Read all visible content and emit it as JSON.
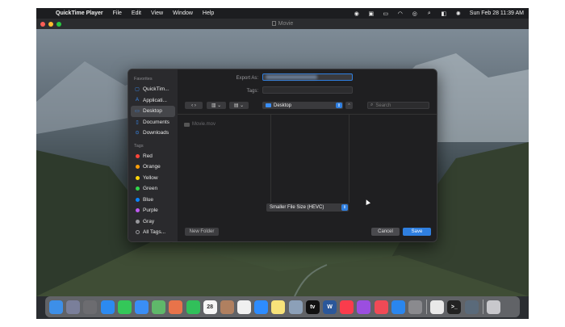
{
  "menubar": {
    "app_name": "QuickTime Player",
    "items": [
      "File",
      "Edit",
      "View",
      "Window",
      "Help"
    ],
    "clock": "Sun Feb 28  11:39 AM"
  },
  "window": {
    "title": "Movie"
  },
  "dialog": {
    "export_as_label": "Export As:",
    "tags_label": "Tags:",
    "location": "Desktop",
    "search_placeholder": "Search",
    "file_name": "Movie.mov",
    "format": "Smaller File Size (HEVC)",
    "new_folder": "New Folder",
    "cancel": "Cancel",
    "save": "Save"
  },
  "sidebar": {
    "favorites_header": "Favorites",
    "favorites": [
      {
        "label": "QuickTim...",
        "icon": "quicktime-icon"
      },
      {
        "label": "Applicati...",
        "icon": "applications-icon"
      },
      {
        "label": "Desktop",
        "icon": "desktop-icon"
      },
      {
        "label": "Documents",
        "icon": "documents-icon"
      },
      {
        "label": "Downloads",
        "icon": "downloads-icon"
      }
    ],
    "tags_header": "Tags",
    "tags": [
      {
        "label": "Red",
        "color": "#ff453a"
      },
      {
        "label": "Orange",
        "color": "#ff9f0a"
      },
      {
        "label": "Yellow",
        "color": "#ffd60a"
      },
      {
        "label": "Green",
        "color": "#32d74b"
      },
      {
        "label": "Blue",
        "color": "#0a84ff"
      },
      {
        "label": "Purple",
        "color": "#bf5af2"
      },
      {
        "label": "Gray",
        "color": "#98989d"
      },
      {
        "label": "All Tags...",
        "color": ""
      }
    ]
  },
  "dock": {
    "apps": [
      {
        "name": "finder",
        "color": "#3d8fe8",
        "glyph": ""
      },
      {
        "name": "launchpad",
        "color": "#7a7f9a",
        "glyph": ""
      },
      {
        "name": "screenshot",
        "color": "#6c6c70",
        "glyph": ""
      },
      {
        "name": "safari",
        "color": "#2c8af0",
        "glyph": ""
      },
      {
        "name": "messages",
        "color": "#34c759",
        "glyph": ""
      },
      {
        "name": "mail",
        "color": "#3a8ef6",
        "glyph": ""
      },
      {
        "name": "maps",
        "color": "#5fb86a",
        "glyph": ""
      },
      {
        "name": "photos",
        "color": "#e8734a",
        "glyph": ""
      },
      {
        "name": "facetime",
        "color": "#31c05a",
        "glyph": ""
      },
      {
        "name": "calendar",
        "color": "#f5f5f5",
        "glyph": "28"
      },
      {
        "name": "contacts",
        "color": "#b08060",
        "glyph": ""
      },
      {
        "name": "reminders",
        "color": "#f0f0f0",
        "glyph": ""
      },
      {
        "name": "zoom",
        "color": "#2d8cff",
        "glyph": ""
      },
      {
        "name": "notes",
        "color": "#f7e27a",
        "glyph": ""
      },
      {
        "name": "preview",
        "color": "#8ca0b8",
        "glyph": ""
      },
      {
        "name": "apple-tv",
        "color": "#111111",
        "glyph": "tv"
      },
      {
        "name": "word",
        "color": "#2b579a",
        "glyph": "W"
      },
      {
        "name": "music",
        "color": "#fa3c4c",
        "glyph": ""
      },
      {
        "name": "podcasts",
        "color": "#9b4ee0",
        "glyph": ""
      },
      {
        "name": "news",
        "color": "#f04a56",
        "glyph": ""
      },
      {
        "name": "app-store",
        "color": "#2a86ee",
        "glyph": ""
      },
      {
        "name": "system-preferences",
        "color": "#8a8a8e",
        "glyph": ""
      },
      {
        "name": "chrome",
        "color": "#e9e9e9",
        "glyph": ""
      },
      {
        "name": "terminal",
        "color": "#222222",
        "glyph": ">_"
      },
      {
        "name": "quicktime",
        "color": "#5a6a7a",
        "glyph": ""
      },
      {
        "name": "trash",
        "color": "#c8c8cc",
        "glyph": ""
      }
    ]
  }
}
